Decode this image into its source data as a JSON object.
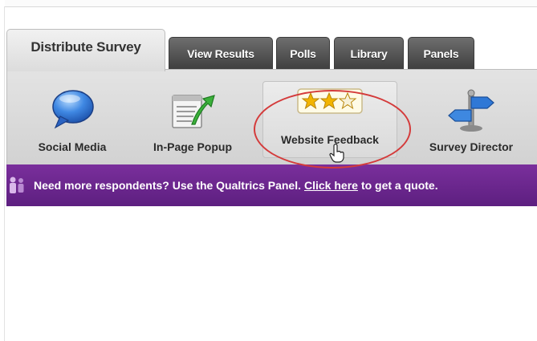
{
  "tabs": [
    {
      "label": "Distribute Survey",
      "active": true
    },
    {
      "label": "View Results",
      "active": false
    },
    {
      "label": "Polls",
      "active": false
    },
    {
      "label": "Library",
      "active": false
    },
    {
      "label": "Panels",
      "active": false
    }
  ],
  "toolbar": {
    "items": [
      {
        "label": "Social Media",
        "icon": "speech-bubble-icon"
      },
      {
        "label": "In-Page Popup",
        "icon": "popup-window-arrow-icon"
      },
      {
        "label": "Website Feedback",
        "icon": "star-rating-icon"
      },
      {
        "label": "Survey Director",
        "icon": "signpost-icon"
      }
    ],
    "selected": "Website Feedback"
  },
  "banner": {
    "text_before": "Need more respondents? Use the Qualtrics Panel.",
    "link": "Click here",
    "text_after": "to get a quote."
  },
  "colors": {
    "banner_purple": "#6a2790",
    "highlight_red": "#d43b3b",
    "tab_dark": "#4f4f4f",
    "tab_active": "#e6e6e6"
  }
}
